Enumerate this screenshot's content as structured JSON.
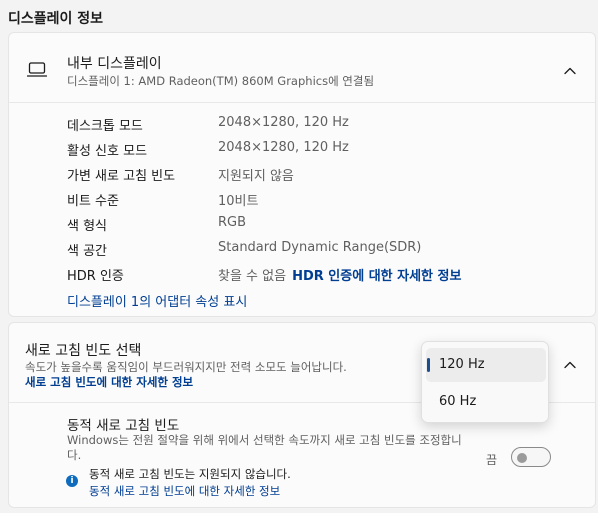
{
  "section_title": "디스플레이 정보",
  "display": {
    "title": "내부 디스플레이",
    "subtitle": "디스플레이 1: AMD Radeon(TM) 860M Graphics에 연결됨",
    "icon": "monitor-icon",
    "expanded": true
  },
  "properties": [
    {
      "label": "데스크톱 모드",
      "value": "2048×1280, 120 Hz"
    },
    {
      "label": "활성 신호 모드",
      "value": "2048×1280, 120 Hz"
    },
    {
      "label": "가변 새로 고침 빈도",
      "value": "지원되지 않음"
    },
    {
      "label": "비트 수준",
      "value": "10비트"
    },
    {
      "label": "색 형식",
      "value": "RGB"
    },
    {
      "label": "색 공간",
      "value": "Standard Dynamic Range(SDR)"
    },
    {
      "label": "HDR 인증",
      "value": "찾을 수 없음",
      "link": "HDR 인증에 대한 자세한 정보"
    }
  ],
  "adapter_link": "디스플레이 1의 어댑터 속성 표시",
  "refresh": {
    "title": "새로 고침 빈도 선택",
    "description": "속도가 높을수록 움직임이 부드러워지지만 전력 소모도 늘어납니다.",
    "link": "새로 고침 빈도에 대한 자세한 정보",
    "options": [
      "120 Hz",
      "60 Hz"
    ],
    "selected": "120 Hz"
  },
  "dynamic": {
    "title": "동적 새로 고침 빈도",
    "description": "Windows는 전원 절약을 위해 위에서 선택한 속도까지 새로 고침 빈도를 조정합니다.",
    "toggle_label": "끔",
    "toggle_on": false,
    "note": "동적 새로 고침 빈도는 지원되지 않습니다.",
    "note_link": "동적 새로 고침 빈도에 대한 자세한 정보"
  },
  "colors": {
    "accent": "#0f6cbd",
    "link": "#003e92"
  }
}
